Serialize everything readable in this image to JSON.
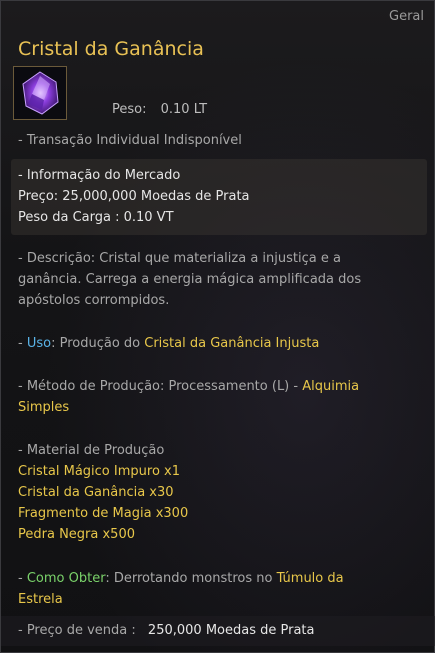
{
  "category": "Geral",
  "title": "Cristal da Ganância",
  "weight": {
    "label": "Peso:",
    "value": "0.10 LT"
  },
  "transaction": "- Transação Individual Indisponível",
  "market": {
    "header": "- Informação do Mercado",
    "price": "Preço: 25,000,000 Moedas de Prata",
    "load_weight": "Peso da Carga : 0.10 VT"
  },
  "description": {
    "line1": "- Descrição: Cristal que materializa a injustiça e a",
    "line2": "ganância. Carrega a energia mágica amplificada dos",
    "line3": "apóstolos corrompidos."
  },
  "use": {
    "prefix": "- ",
    "label": "Uso",
    "text": ": Produção do ",
    "target": "Cristal da Ganância Injusta"
  },
  "production_method": {
    "text": "- Método de Produção: Processamento (L) - ",
    "method_part1": "Alquimia",
    "method_part2": "Simples"
  },
  "materials": {
    "header": "- Material de Produção",
    "items": [
      "Cristal Mágico Impuro x1",
      "Cristal da Ganância x30",
      "Fragmento de Magia x300",
      "Pedra Negra x500"
    ]
  },
  "how_to_obtain": {
    "prefix": "- ",
    "label": "Como Obter",
    "text": ": Derrotando monstros no ",
    "place_part1": "Túmulo da",
    "place_part2": "Estrela"
  },
  "sell_price": {
    "label": "- Preço de venda :",
    "value": "250,000 Moedas de Prata"
  },
  "colors": {
    "title": "#e9c255",
    "highlight": "#e8c74a",
    "use_label": "#5ab4e8",
    "obtain_label": "#7ad26a"
  },
  "icon": "purple-crystal-icon"
}
